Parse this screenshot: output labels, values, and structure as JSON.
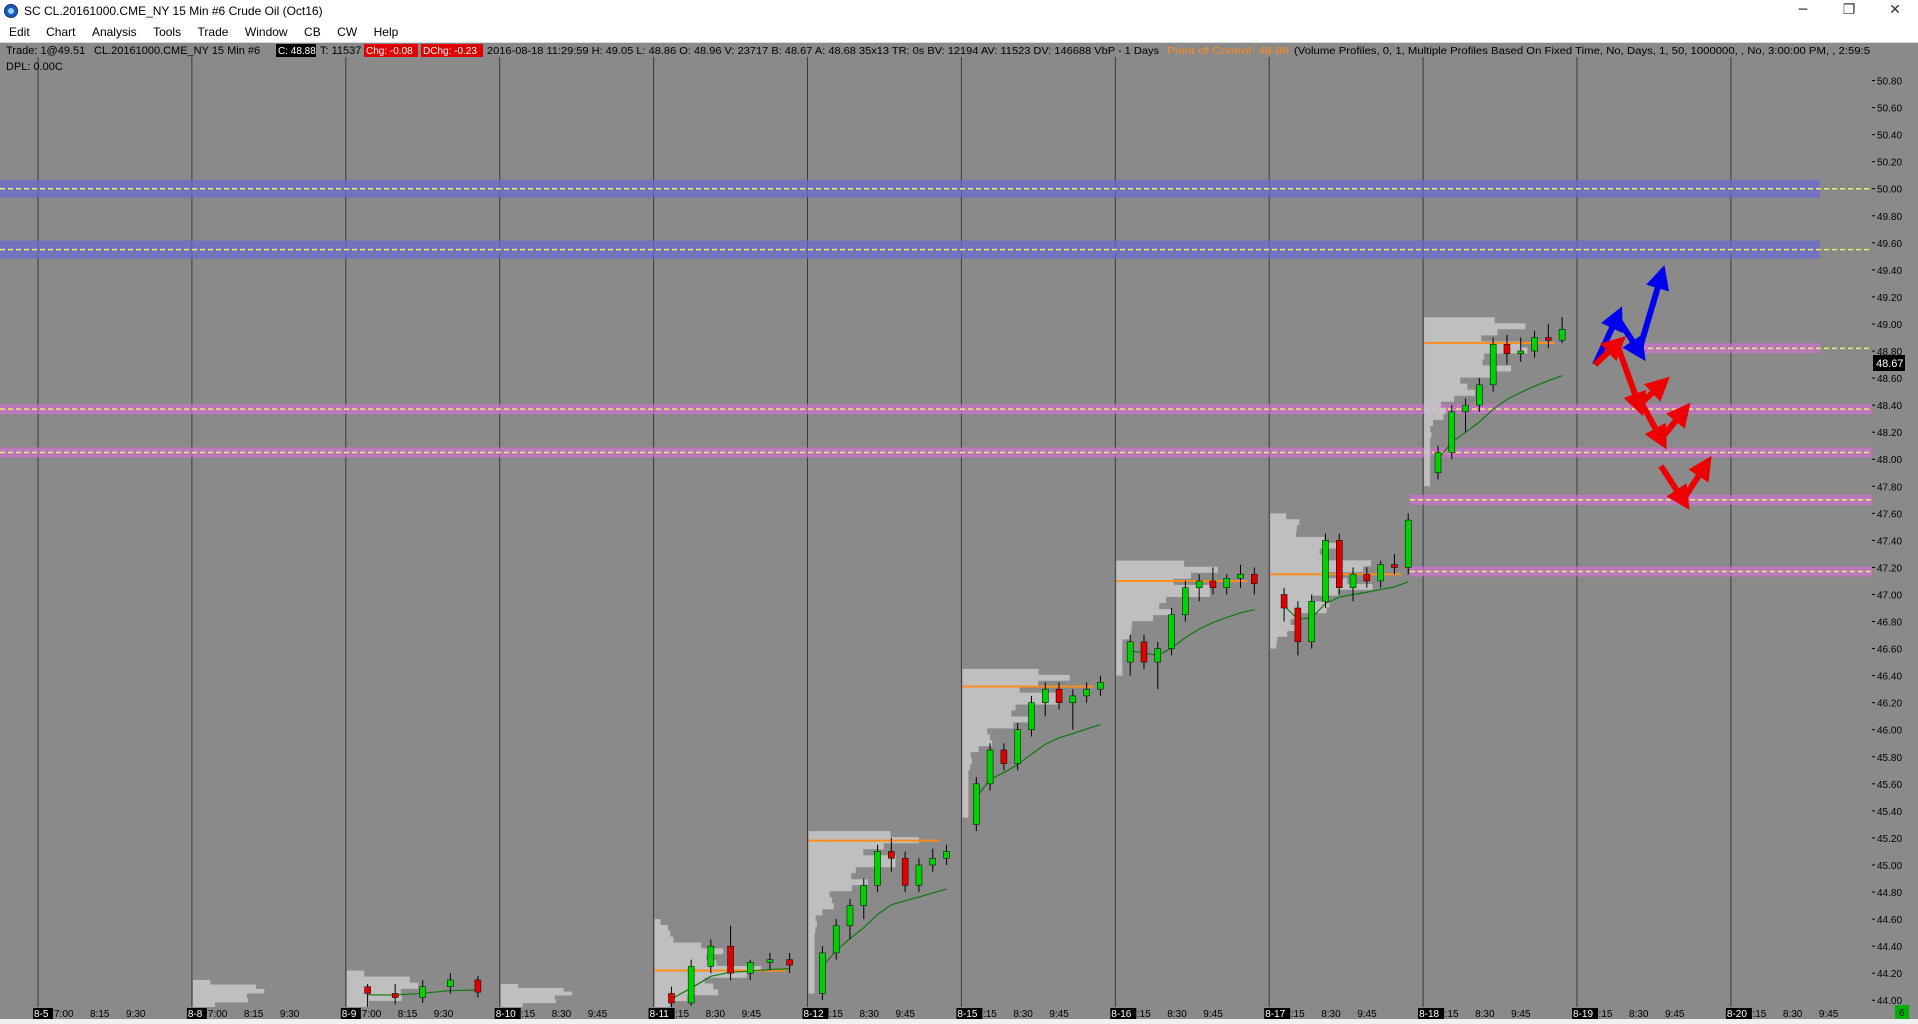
{
  "window": {
    "title": "SC CL.20161000.CME_NY  15 Min  #6  Crude Oil (Oct16)",
    "minimize_glyph": "─",
    "restore_glyph": "❐",
    "close_glyph": "✕"
  },
  "menu": [
    {
      "label": "Edit"
    },
    {
      "label": "Chart"
    },
    {
      "label": "Analysis"
    },
    {
      "label": "Tools"
    },
    {
      "label": "Trade"
    },
    {
      "label": "Window"
    },
    {
      "label": "CB"
    },
    {
      "label": "CW"
    },
    {
      "label": "Help"
    }
  ],
  "info_line": {
    "trade": "Trade: 1@49.51",
    "symbol": "CL.20161000.CME_NY  15 Min  #6",
    "close_badge": "C: 48.88",
    "total_volume": "T: 11537",
    "chg_badge": "Chg: -0.08",
    "dchg_badge": "DChg: -0.23",
    "bar_info": "2016-08-18 11:29:59 H: 49.05 L: 48.86 O: 48.96 V: 23717 B: 48.67 A: 48.68 35x13 TR: 0s BV: 12194 AV: 11523 DV: 146688  VbP - 1 Days",
    "poc": "Point of Control: 48.86",
    "study_params": "(Volume Profiles, 0, 1, Multiple Profiles Based On Fixed Time, No, Days, 1, 50, 1000000, , No, 3:00:00 PM, , 2:59:5"
  },
  "dpl_label": "DPL: 0.00C",
  "current_price": "48.67",
  "bottom_right_badge": "6",
  "colors": {
    "chart_bg": "#8a8a8a",
    "session_line": "#3a3a3a",
    "up_candle": "#00d200",
    "down_candle": "#e00000",
    "wick": "#000000",
    "vwap": "#0c7a0c",
    "poc_line": "#ff8c1a",
    "profile_light": "#c8c8c8",
    "profile_dark": "#6e6e6e",
    "blue_zone": "#6a6ad0",
    "pink_zone": "#d070d0",
    "yellow_dash": "#f0f070",
    "arrow_blue": "#0000ee",
    "arrow_red": "#ee0000"
  },
  "chart_data": {
    "type": "candlestick",
    "y_axis": {
      "min": 43.95,
      "max": 50.9,
      "labels": [
        "50.80",
        "50.60",
        "50.40",
        "50.20",
        "50.00",
        "49.80",
        "49.60",
        "49.40",
        "49.20",
        "49.00",
        "48.80",
        "48.60",
        "48.40",
        "48.20",
        "48.00",
        "47.80",
        "47.60",
        "47.40",
        "47.20",
        "47.00",
        "46.80",
        "46.60",
        "46.40",
        "46.20",
        "46.00",
        "45.80",
        "45.60",
        "45.40",
        "45.20",
        "45.00",
        "44.80",
        "44.60",
        "44.40",
        "44.20",
        "44.00"
      ]
    },
    "sessions": [
      {
        "date": "8-5",
        "ticks": [
          "7:00",
          "8:15",
          "9:30"
        ]
      },
      {
        "date": "8-8",
        "ticks": [
          "7:00",
          "8:15",
          "9:30"
        ]
      },
      {
        "date": "8-9",
        "ticks": [
          "7:00",
          "8:15",
          "9:30"
        ]
      },
      {
        "date": "8-10",
        "ticks": [
          "7:15",
          "8:30",
          "9:45"
        ]
      },
      {
        "date": "8-11",
        "ticks": [
          "7:15",
          "8:30",
          "9:45"
        ]
      },
      {
        "date": "8-12",
        "ticks": [
          "7:15",
          "8:30",
          "9:45"
        ]
      },
      {
        "date": "8-15",
        "ticks": [
          "7:15",
          "8:30",
          "9:45"
        ]
      },
      {
        "date": "8-16",
        "ticks": [
          "7:15",
          "8:30",
          "9:45"
        ]
      },
      {
        "date": "8-17",
        "ticks": [
          "7:15",
          "8:30",
          "9:45"
        ]
      },
      {
        "date": "8-18",
        "ticks": [
          "7:15",
          "8:30",
          "9:45"
        ]
      },
      {
        "date": "8-19",
        "ticks": [
          "7:15",
          "8:30",
          "9:45"
        ]
      },
      {
        "date": "8-20",
        "ticks": [
          "7:15",
          "8:30",
          "9:45"
        ]
      }
    ],
    "daily_bars": [
      {
        "session": "8-9",
        "bars": [
          [
            44.1,
            44.12,
            43.95,
            44.05
          ],
          [
            44.05,
            44.12,
            43.97,
            44.02
          ],
          [
            44.02,
            44.15,
            43.98,
            44.1
          ],
          [
            44.1,
            44.2,
            44.05,
            44.15
          ],
          [
            44.15,
            44.18,
            44.02,
            44.06
          ]
        ]
      },
      {
        "session": "8-11",
        "bars": [
          [
            44.05,
            44.1,
            43.95,
            43.98
          ],
          [
            43.98,
            44.3,
            43.96,
            44.25
          ],
          [
            44.25,
            44.45,
            44.2,
            44.4
          ],
          [
            44.4,
            44.55,
            44.15,
            44.2
          ],
          [
            44.2,
            44.3,
            44.15,
            44.28
          ],
          [
            44.28,
            44.35,
            44.22,
            44.3
          ],
          [
            44.3,
            44.35,
            44.2,
            44.26
          ]
        ]
      },
      {
        "session": "8-12",
        "bars": [
          [
            44.05,
            44.4,
            44.0,
            44.35
          ],
          [
            44.35,
            44.6,
            44.3,
            44.55
          ],
          [
            44.55,
            44.75,
            44.45,
            44.7
          ],
          [
            44.7,
            44.9,
            44.6,
            44.85
          ],
          [
            44.85,
            45.15,
            44.8,
            45.1
          ],
          [
            45.1,
            45.2,
            44.95,
            45.05
          ],
          [
            45.05,
            45.1,
            44.8,
            44.85
          ],
          [
            44.85,
            45.05,
            44.8,
            45.0
          ],
          [
            45.0,
            45.12,
            44.95,
            45.05
          ],
          [
            45.05,
            45.15,
            45.0,
            45.1
          ]
        ]
      },
      {
        "session": "8-15",
        "bars": [
          [
            45.3,
            45.65,
            45.25,
            45.6
          ],
          [
            45.6,
            45.9,
            45.55,
            45.85
          ],
          [
            45.85,
            45.9,
            45.7,
            45.75
          ],
          [
            45.75,
            46.05,
            45.7,
            46.0
          ],
          [
            46.0,
            46.25,
            45.95,
            46.2
          ],
          [
            46.2,
            46.35,
            46.1,
            46.3
          ],
          [
            46.3,
            46.35,
            46.15,
            46.2
          ],
          [
            46.2,
            46.3,
            46.0,
            46.25
          ],
          [
            46.25,
            46.35,
            46.2,
            46.3
          ],
          [
            46.3,
            46.4,
            46.25,
            46.35
          ]
        ]
      },
      {
        "session": "8-16",
        "bars": [
          [
            46.5,
            46.7,
            46.4,
            46.65
          ],
          [
            46.65,
            46.7,
            46.45,
            46.5
          ],
          [
            46.5,
            46.65,
            46.3,
            46.6
          ],
          [
            46.6,
            46.9,
            46.55,
            46.85
          ],
          [
            46.85,
            47.1,
            46.8,
            47.05
          ],
          [
            47.05,
            47.15,
            46.95,
            47.1
          ],
          [
            47.1,
            47.2,
            47.0,
            47.05
          ],
          [
            47.05,
            47.15,
            47.0,
            47.12
          ],
          [
            47.12,
            47.22,
            47.05,
            47.15
          ],
          [
            47.15,
            47.2,
            47.0,
            47.08
          ]
        ]
      },
      {
        "session": "8-17",
        "bars": [
          [
            47.0,
            47.05,
            46.8,
            46.9
          ],
          [
            46.9,
            46.95,
            46.55,
            46.65
          ],
          [
            46.65,
            47.0,
            46.6,
            46.95
          ],
          [
            46.95,
            47.45,
            46.9,
            47.4
          ],
          [
            47.4,
            47.45,
            47.0,
            47.05
          ],
          [
            47.05,
            47.2,
            46.95,
            47.15
          ],
          [
            47.15,
            47.2,
            47.05,
            47.1
          ],
          [
            47.1,
            47.25,
            47.05,
            47.22
          ],
          [
            47.22,
            47.3,
            47.15,
            47.2
          ],
          [
            47.2,
            47.6,
            47.15,
            47.55
          ]
        ]
      },
      {
        "session": "8-18",
        "bars": [
          [
            47.9,
            48.1,
            47.85,
            48.05
          ],
          [
            48.05,
            48.4,
            48.0,
            48.35
          ],
          [
            48.35,
            48.45,
            48.2,
            48.4
          ],
          [
            48.4,
            48.6,
            48.35,
            48.55
          ],
          [
            48.55,
            48.9,
            48.5,
            48.85
          ],
          [
            48.85,
            48.92,
            48.7,
            48.78
          ],
          [
            48.78,
            48.9,
            48.72,
            48.8
          ],
          [
            48.8,
            48.95,
            48.75,
            48.9
          ],
          [
            48.9,
            49.0,
            48.82,
            48.88
          ],
          [
            48.88,
            49.05,
            48.86,
            48.96
          ]
        ]
      }
    ],
    "volume_profiles": [
      {
        "session": "8-8",
        "high": 44.15,
        "low": 43.95,
        "poc": null
      },
      {
        "session": "8-9",
        "high": 44.22,
        "low": 43.95,
        "poc": null
      },
      {
        "session": "8-10",
        "high": 44.12,
        "low": 43.95,
        "poc": null
      },
      {
        "session": "8-11",
        "high": 44.6,
        "low": 43.95,
        "poc": 44.22
      },
      {
        "session": "8-12",
        "high": 45.25,
        "low": 44.05,
        "poc": 45.18
      },
      {
        "session": "8-15",
        "high": 46.45,
        "low": 45.35,
        "poc": 46.32
      },
      {
        "session": "8-16",
        "high": 47.25,
        "low": 46.4,
        "poc": 47.1
      },
      {
        "session": "8-17",
        "high": 47.6,
        "low": 46.6,
        "poc": 47.15
      },
      {
        "session": "8-18",
        "high": 49.05,
        "low": 47.8,
        "poc": 48.86
      }
    ],
    "horizontal_levels": [
      {
        "price": 50.0,
        "style": "blue_zone"
      },
      {
        "price": 49.55,
        "style": "blue_zone"
      },
      {
        "price": 48.82,
        "style": "pink_zone_right"
      },
      {
        "price": 48.37,
        "style": "pink_zone"
      },
      {
        "price": 48.05,
        "style": "pink_zone"
      },
      {
        "price": 47.7,
        "style": "pink_zone_right"
      },
      {
        "price": 47.17,
        "style": "pink_zone_right"
      }
    ],
    "scenario_arrows": [
      {
        "color": "blue",
        "points": [
          [
            48.7,
            0
          ],
          [
            49.05,
            1
          ],
          [
            48.8,
            2
          ],
          [
            49.35,
            3
          ]
        ]
      },
      {
        "color": "red",
        "points": [
          [
            48.7,
            0
          ],
          [
            48.85,
            1
          ],
          [
            48.4,
            2
          ],
          [
            48.55,
            3
          ]
        ]
      },
      {
        "color": "red",
        "points": [
          [
            48.45,
            2
          ],
          [
            48.15,
            3
          ],
          [
            48.35,
            4
          ]
        ]
      },
      {
        "color": "red",
        "points": [
          [
            47.95,
            3
          ],
          [
            47.7,
            4
          ],
          [
            47.95,
            5
          ]
        ]
      }
    ],
    "grid": false,
    "legend": "none"
  }
}
